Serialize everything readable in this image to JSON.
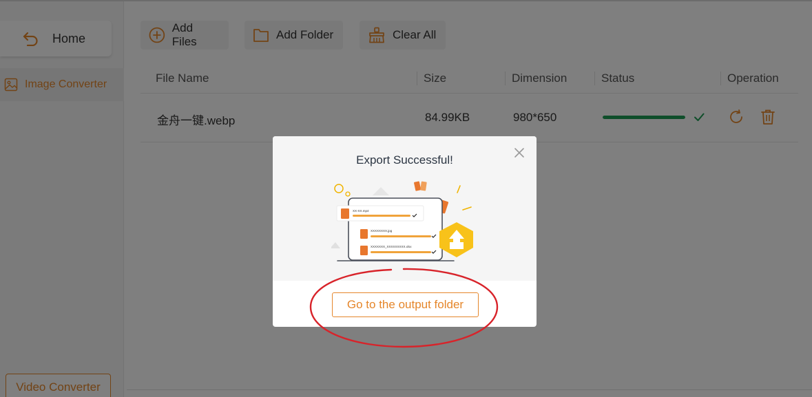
{
  "sidebar": {
    "home_label": "Home",
    "image_converter_label": "Image Converter",
    "video_converter_label": "Video Converter"
  },
  "toolbar": {
    "add_files_label": "Add Files",
    "add_folder_label": "Add Folder",
    "clear_all_label": "Clear All"
  },
  "table": {
    "columns": [
      "File Name",
      "Size",
      "Dimension",
      "Status",
      "Operation"
    ],
    "rows": [
      {
        "file_name": "金舟一键.webp",
        "size": "84.99KB",
        "dimension": "980*650",
        "progress": 1.0,
        "status_icon": "check-icon"
      }
    ]
  },
  "dialog": {
    "title": "Export Successful!",
    "button_label": "Go to the output folder",
    "illustration_files": [
      "XX-XX.mp4",
      "XXXXXXXX.jpg",
      "XXXXXXX_XXXXXXXXX.xlsx"
    ]
  },
  "colors": {
    "accent": "#e5862a",
    "success": "#1f9d55",
    "annotation": "#d8232a"
  }
}
